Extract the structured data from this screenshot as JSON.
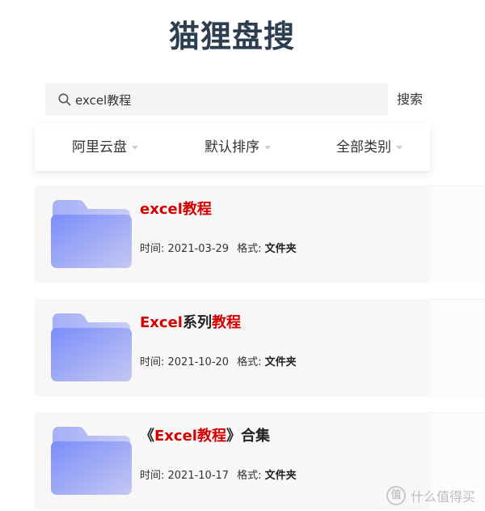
{
  "app": {
    "title": "猫狸盘搜"
  },
  "search": {
    "value": "excel教程",
    "button_label": "搜索"
  },
  "filters": [
    {
      "label": "阿里云盘"
    },
    {
      "label": "默认排序"
    },
    {
      "label": "全部类别"
    }
  ],
  "meta_labels": {
    "time": "时间: ",
    "format": "格式: "
  },
  "results": [
    {
      "title_parts": [
        {
          "text": "excel教程",
          "highlight": true
        }
      ],
      "time": "2021-03-29",
      "format": "文件夹"
    },
    {
      "title_parts": [
        {
          "text": "Excel",
          "highlight": true
        },
        {
          "text": "系列",
          "highlight": false
        },
        {
          "text": "教程",
          "highlight": true
        }
      ],
      "time": "2021-10-20",
      "format": "文件夹"
    },
    {
      "title_parts": [
        {
          "text": "《",
          "highlight": false
        },
        {
          "text": "Excel教程",
          "highlight": true
        },
        {
          "text": "》合集",
          "highlight": false
        }
      ],
      "time": "2021-10-17",
      "format": "文件夹"
    }
  ],
  "watermark": {
    "logo_char": "值",
    "text": "什么值得买"
  },
  "colors": {
    "highlight": "#d40000",
    "title": "#2c3e50"
  }
}
